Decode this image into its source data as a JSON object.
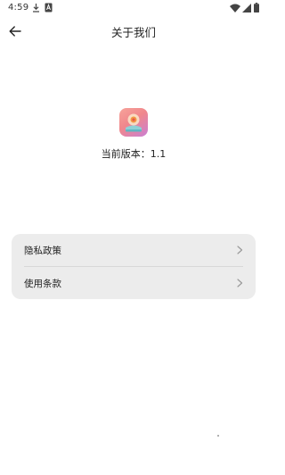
{
  "status_bar": {
    "time": "4:59",
    "icons": [
      "download-icon",
      "notification-a-icon",
      "wifi-icon",
      "signal-icon",
      "battery-icon"
    ]
  },
  "header": {
    "title": "关于我们",
    "back_icon": "back-arrow-icon"
  },
  "app_info": {
    "logo_icon": "app-logo-icon",
    "version_label": "当前版本：1.1"
  },
  "menu": {
    "items": [
      {
        "label": "隐私政策",
        "icon": "chevron-right-icon"
      },
      {
        "label": "使用条款",
        "icon": "chevron-right-icon"
      }
    ]
  },
  "colors": {
    "card_background": "#ececec",
    "divider": "#d8d8d8",
    "text": "#222222",
    "chevron": "#9a9a9a"
  }
}
